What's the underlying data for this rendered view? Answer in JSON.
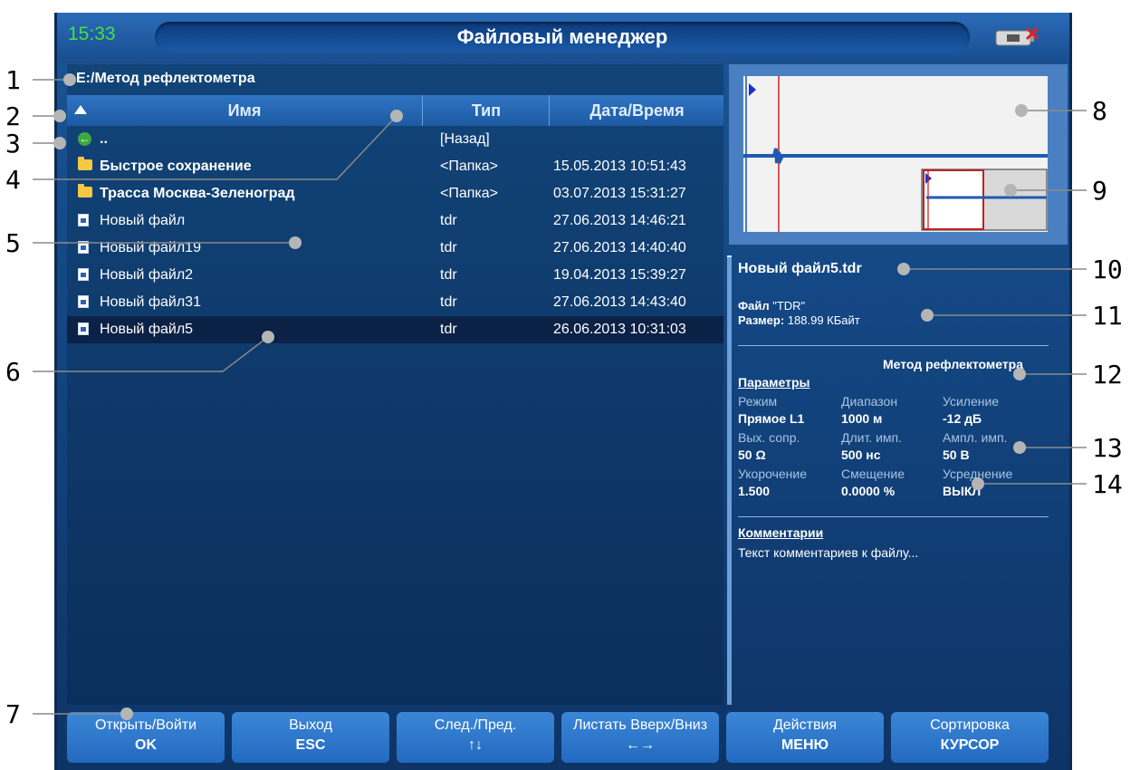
{
  "status": {
    "time": "15:33",
    "title": "Файловый менеджер"
  },
  "path": "E:/Метод рефлектометра",
  "columns": {
    "name": "Имя",
    "type": "Тип",
    "date": "Дата/Время"
  },
  "rows": [
    {
      "icon": "back",
      "name": "..",
      "type": "[Назад]",
      "date": ""
    },
    {
      "icon": "folder",
      "name": "Быстрое сохранение",
      "type": "<Папка>",
      "date": "15.05.2013 10:51:43"
    },
    {
      "icon": "folder",
      "name": "Трасса Москва-Зеленоград",
      "type": "<Папка>",
      "date": "03.07.2013 15:31:27"
    },
    {
      "icon": "file",
      "name": "Новый файл",
      "type": "tdr",
      "date": "27.06.2013 14:46:21"
    },
    {
      "icon": "file",
      "name": "Новый файл19",
      "type": "tdr",
      "date": "27.06.2013 14:40:40"
    },
    {
      "icon": "file",
      "name": "Новый файл2",
      "type": "tdr",
      "date": "19.04.2013 15:39:27"
    },
    {
      "icon": "file",
      "name": "Новый файл31",
      "type": "tdr",
      "date": "27.06.2013 14:43:40"
    },
    {
      "icon": "file",
      "name": "Новый файл5",
      "type": "tdr",
      "date": "26.06.2013 10:31:03"
    }
  ],
  "details": {
    "filename": "Новый файл5.tdr",
    "file_label": "Файл",
    "file_type": "\"TDR\"",
    "size_label": "Размер:",
    "size_value": "188.99 КБайт",
    "method": "Метод рефлектометра",
    "params_title": "Параметры",
    "params": [
      {
        "label": "Режим",
        "value": "Прямое L1"
      },
      {
        "label": "Диапазон",
        "value": "1000 м"
      },
      {
        "label": "Усиление",
        "value": "-12 дБ"
      },
      {
        "label": "Вых. сопр.",
        "value": "50 Ω"
      },
      {
        "label": "Длит. имп.",
        "value": "500 нс"
      },
      {
        "label": "Ампл. имп.",
        "value": "50 В"
      },
      {
        "label": "Укорочение",
        "value": "1.500"
      },
      {
        "label": "Смещение",
        "value": "0.0000 %"
      },
      {
        "label": "Усреднение",
        "value": "ВЫКЛ"
      }
    ],
    "comments_title": "Комментарии",
    "comments": "Текст комментариев к файлу..."
  },
  "buttons": [
    {
      "l1": "Открыть/Войти",
      "l2": "OK"
    },
    {
      "l1": "Выход",
      "l2": "ESC"
    },
    {
      "l1": "След./Пред.",
      "l2": "↑↓"
    },
    {
      "l1": "Листать Вверх/Вниз",
      "l2": "←→"
    },
    {
      "l1": "Действия",
      "l2": "МЕНЮ"
    },
    {
      "l1": "Сортировка",
      "l2": "КУРСОР"
    }
  ],
  "callouts": [
    "1",
    "2",
    "3",
    "4",
    "5",
    "6",
    "7",
    "8",
    "9",
    "10",
    "11",
    "12",
    "13",
    "14"
  ],
  "colors": {
    "time": "#45e040",
    "accent": "#1b5596",
    "selection": "#0b2146",
    "trace": "#1f5ab0",
    "marker": "#d42020"
  }
}
